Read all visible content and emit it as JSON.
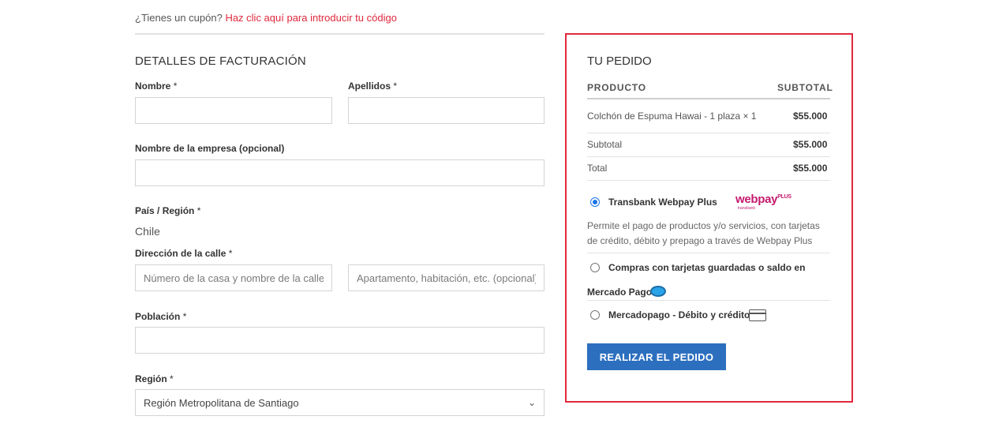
{
  "coupon": {
    "prompt": "¿Tienes un cupón?",
    "link": "Haz clic aquí para introducir tu código"
  },
  "billing": {
    "title": "DETALLES DE FACTURACIÓN",
    "required_mark": "*",
    "first_name_label": "Nombre",
    "last_name_label": "Apellidos",
    "company_label": "Nombre de la empresa (opcional)",
    "country_label": "País / Región",
    "country_value": "Chile",
    "street_label": "Dirección de la calle",
    "street1_placeholder": "Número de la casa y nombre de la calle",
    "street2_placeholder": "Apartamento, habitación, etc. (opcional)",
    "city_label": "Población",
    "region_label": "Región",
    "region_value": "Región Metropolitana de Santiago"
  },
  "order": {
    "title": "TU PEDIDO",
    "col_product": "PRODUCTO",
    "col_subtotal": "SUBTOTAL",
    "item_name": "Colchón de Espuma Hawai - 1 plaza",
    "item_qty": "× 1",
    "item_amount": "$55.000",
    "subtotal_label": "Subtotal",
    "subtotal_amount": "$55.000",
    "total_label": "Total",
    "total_amount": "$55.000"
  },
  "payment": {
    "transbank_label": "Transbank Webpay Plus",
    "webpay_logo": "webpay",
    "webpay_plus": "PLUS",
    "webpay_sub": "transbank",
    "transbank_desc": "Permite el pago de productos y/o servicios, con tarjetas de crédito, débito y prepago a través de Webpay Plus",
    "mp_saved_label_1": "Compras con tarjetas guardadas o saldo en",
    "mp_saved_label_2": "Mercado Pago",
    "mp_card_label": "Mercadopago - Débito y crédito",
    "mp_icon": "mercadopago-handshake-icon",
    "card_icon": "credit-card-icon"
  },
  "place_order_label": "REALIZAR EL PEDIDO",
  "colors": {
    "accent_red": "#e0283c",
    "button_blue": "#2c6fbf",
    "radio_blue": "#1a73e8"
  }
}
